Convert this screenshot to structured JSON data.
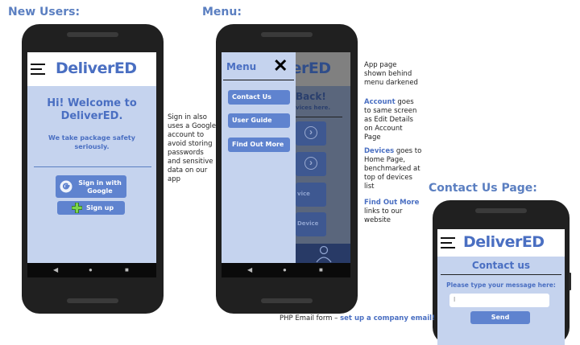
{
  "headings": {
    "new_users": "New Users:",
    "menu": "Menu:",
    "contact_page": "Contact Us Page:"
  },
  "app": {
    "logo": "DeliverED",
    "nav_back": "◀",
    "nav_home": "●",
    "nav_recent": "■"
  },
  "new_users_screen": {
    "welcome_line1": "Hi! Welcome to",
    "welcome_line2": "DeliverED.",
    "tagline_line1": "We take package safety",
    "tagline_line2": "seriously.",
    "google_label_line1": "Sign in with",
    "google_label_line2": "Google",
    "signup_label": "Sign up"
  },
  "menu_screen": {
    "menu_title": "Menu",
    "close_glyph": "✕",
    "items": [
      "Contact Us",
      "User Guide",
      "Find Out More"
    ],
    "bg_back_text": "Back!",
    "bg_devices_text": "vices here.",
    "bg_card3": "vice",
    "bg_card4": "Device",
    "arrow": "›"
  },
  "contact_screen": {
    "title": "Contact us",
    "prompt": "Please type your message here:",
    "input_value": "I",
    "send_label": "Send"
  },
  "notes": {
    "signin_lines": [
      "Sign in also",
      "uses a Google",
      "account to",
      "avoid storing",
      "passwords",
      "and sensitive",
      "data on our",
      "app"
    ],
    "darken_lines": [
      "App page",
      "shown behind",
      "menu darkened"
    ],
    "account_kw": "Account",
    "account_rest": [
      " goes",
      "to same screen",
      "as Edit Details",
      "on Account",
      "Page"
    ],
    "devices_kw": "Devices",
    "devices_rest": [
      " goes to",
      "Home Page,",
      "benchmarked at",
      "top of devices",
      "list"
    ],
    "findout_kw": "Find Out More",
    "findout_rest": [
      "links to our",
      "website"
    ],
    "php_prefix": "PHP Email form – ",
    "php_link": "set up a company email!"
  },
  "colors": {
    "accent": "#4a6fc2",
    "screen_bg": "#c5d3ee",
    "button": "#5f83cf",
    "heading": "#5b7fc1"
  }
}
